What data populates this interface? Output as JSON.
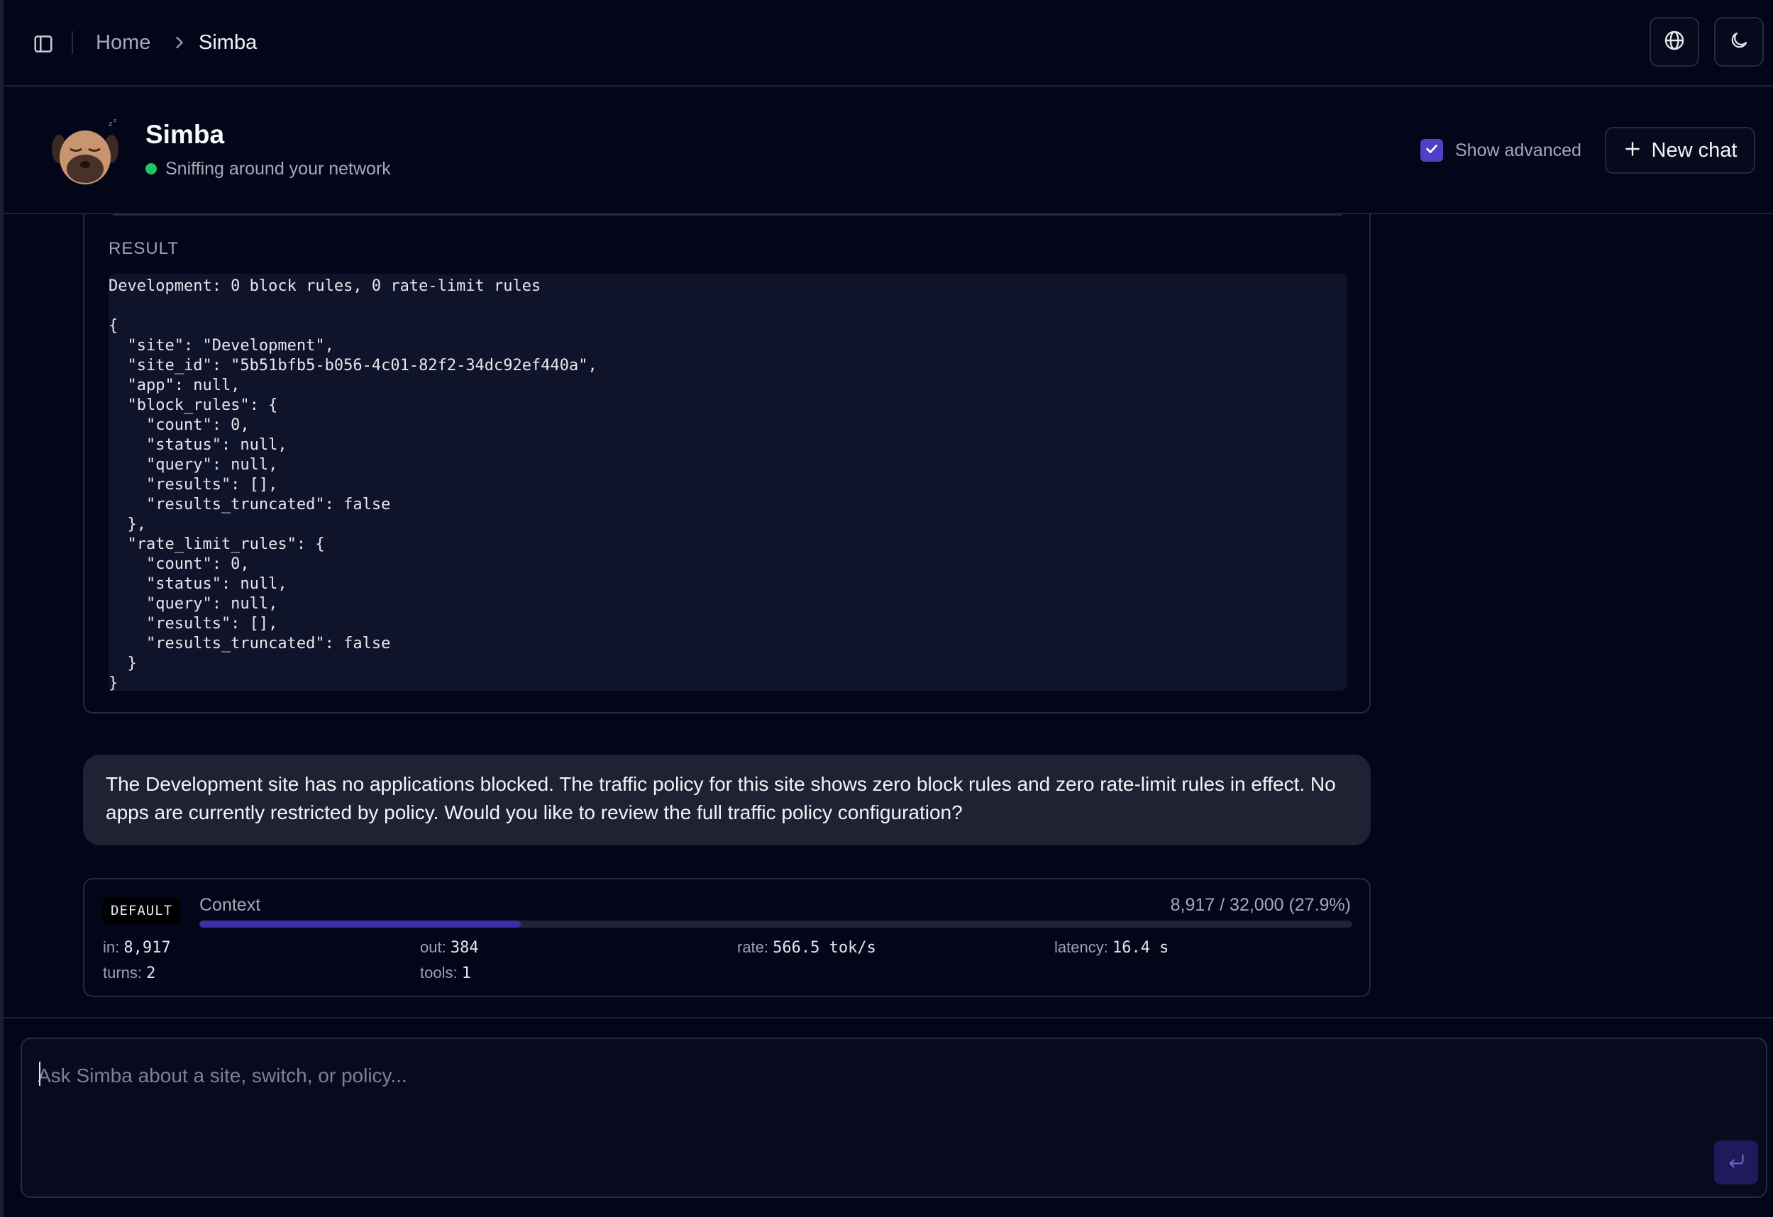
{
  "breadcrumb": {
    "home": "Home",
    "current": "Simba"
  },
  "icons": {
    "sidebar_toggle": "sidebar-toggle-icon",
    "chevron": "chevron-right-icon",
    "globe": "globe-icon",
    "theme": "moon-icon",
    "avatar": "sleeping-pug-avatar",
    "check": "check-icon",
    "plus": "plus-icon",
    "send": "enter-return-icon"
  },
  "agent": {
    "name": "Simba",
    "status": "Sniffing around your network",
    "status_color": "#22c55e"
  },
  "controls": {
    "show_advanced_label": "Show advanced",
    "show_advanced_checked": true,
    "new_chat_label": "New chat"
  },
  "tool_result": {
    "label": "RESULT",
    "code": "Development: 0 block rules, 0 rate-limit rules\n\n{\n  \"site\": \"Development\",\n  \"site_id\": \"5b51bfb5-b056-4c01-82f2-34dc92ef440a\",\n  \"app\": null,\n  \"block_rules\": {\n    \"count\": 0,\n    \"status\": null,\n    \"query\": null,\n    \"results\": [],\n    \"results_truncated\": false\n  },\n  \"rate_limit_rules\": {\n    \"count\": 0,\n    \"status\": null,\n    \"query\": null,\n    \"results\": [],\n    \"results_truncated\": false\n  }\n}"
  },
  "assistant_message": "The Development site has no applications blocked. The traffic policy for this site shows zero block rules and zero rate-limit rules in effect. No apps are currently restricted by policy. Would you like to review the full traffic policy configuration?",
  "stats": {
    "model_badge": "DEFAULT",
    "context_label": "Context",
    "context_value": "8,917 / 32,000 (27.9%)",
    "context_fraction": 0.279,
    "in_label": "in:",
    "in_value": "8,917",
    "out_label": "out:",
    "out_value": "384",
    "rate_label": "rate:",
    "rate_value": "566.5 tok/s",
    "latency_label": "latency:",
    "latency_value": "16.4 s",
    "turns_label": "turns:",
    "turns_value": "2",
    "tools_label": "tools:",
    "tools_value": "1"
  },
  "composer": {
    "placeholder": "Ask Simba about a site, switch, or policy...",
    "value": ""
  },
  "colors": {
    "accent": "#4f3fc9",
    "background": "#030618",
    "bubble": "#1f2233",
    "code_bg": "#10142a"
  }
}
